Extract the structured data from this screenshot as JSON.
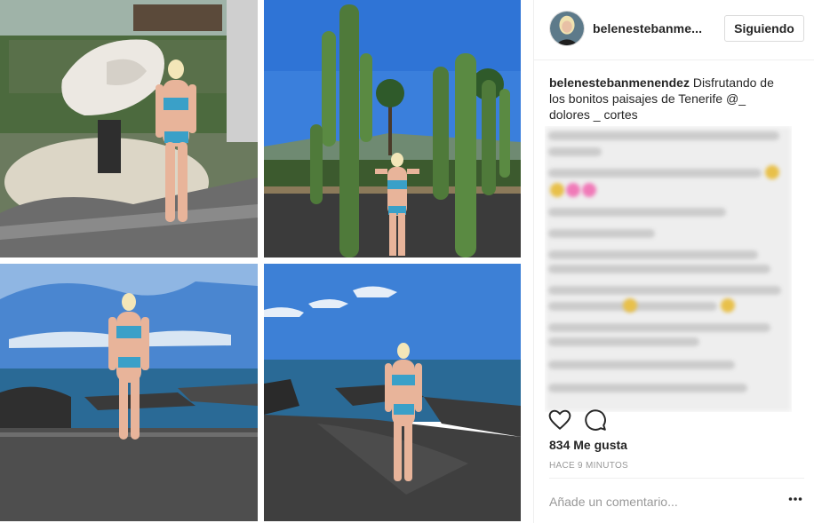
{
  "post": {
    "username": "belenestebanmenendez",
    "username_header": "belenestebanme...",
    "follow_label": "Siguiendo",
    "caption_text": "Disfrutando de los bonitos paisajes de Tenerife @_ dolores _ cortes",
    "likes": "834 Me gusta",
    "timestamp": "HACE 9 MINUTOS",
    "comment_placeholder": "Añade un comentario..."
  },
  "photos": [
    {
      "scene": "hotel garden with white sculpture"
    },
    {
      "scene": "cacti and palm trees"
    },
    {
      "scene": "volcanic beach and sea"
    },
    {
      "scene": "black sand beach and rocks"
    }
  ],
  "colors": {
    "sky": "#3d7fd6",
    "sea": "#2a5f8a",
    "sand": "#4a4a4a",
    "cactus": "#4f7a3a",
    "bikini": "#3aa0c8",
    "skin": "#e8b49a"
  },
  "icons": {
    "like": "heart-icon",
    "comment": "speech-bubble-icon",
    "more": "ellipsis-icon"
  }
}
